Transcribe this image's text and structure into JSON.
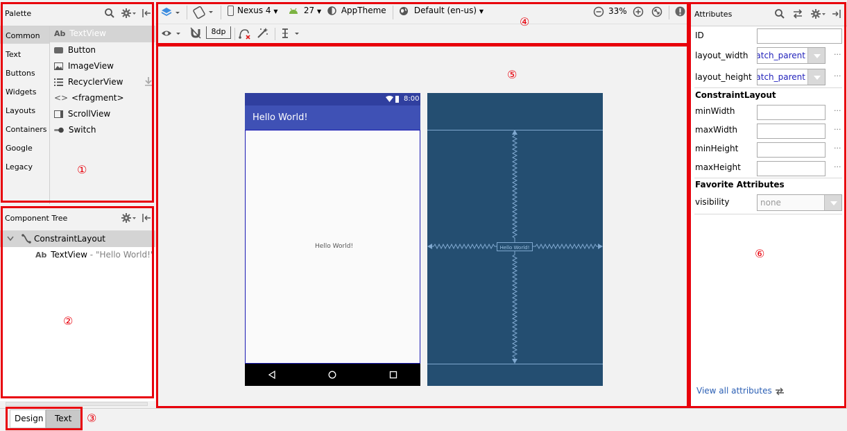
{
  "palette": {
    "title": "Palette",
    "categories": [
      {
        "label": "Common",
        "selected": true
      },
      {
        "label": "Text"
      },
      {
        "label": "Buttons"
      },
      {
        "label": "Widgets"
      },
      {
        "label": "Layouts"
      },
      {
        "label": "Containers"
      },
      {
        "label": "Google"
      },
      {
        "label": "Legacy"
      }
    ],
    "items": [
      {
        "label": "TextView",
        "icon": "Ab",
        "selected": true
      },
      {
        "label": "Button",
        "icon": "button-icon"
      },
      {
        "label": "ImageView",
        "icon": "image-icon"
      },
      {
        "label": "RecyclerView",
        "icon": "list-icon"
      },
      {
        "label": "<fragment>",
        "icon": "code-icon"
      },
      {
        "label": "ScrollView",
        "icon": "scroll-icon"
      },
      {
        "label": "Switch",
        "icon": "switch-icon"
      }
    ]
  },
  "component_tree": {
    "title": "Component Tree",
    "root": "ConstraintLayout",
    "child_label": "TextView",
    "child_detail": "- \"Hello World!\"",
    "child_icon": "Ab"
  },
  "tabs": {
    "design": "Design",
    "text": "Text",
    "active": "Design"
  },
  "toolbar": {
    "device": "Nexus 4",
    "api": "27",
    "theme": "AppTheme",
    "locale": "Default (en-us)",
    "zoom": "33%",
    "margin": "8dp"
  },
  "preview": {
    "status_time": "8:00",
    "app_title": "Hello World!",
    "content_text": "Hello World!",
    "blueprint_text": "Hello World!",
    "colors": {
      "appbar": "#3f51b5",
      "statusbar": "#303f9f",
      "blueprint": "#244e71"
    }
  },
  "attributes": {
    "title": "Attributes",
    "id_label": "ID",
    "id_value": "",
    "layout_width_label": "layout_width",
    "layout_width_value": "match_parent",
    "layout_height_label": "layout_height",
    "layout_height_value": "match_parent",
    "section_constraint": "ConstraintLayout",
    "min_width_label": "minWidth",
    "max_width_label": "maxWidth",
    "min_height_label": "minHeight",
    "max_height_label": "maxHeight",
    "section_favorite": "Favorite Attributes",
    "visibility_label": "visibility",
    "visibility_value": "none",
    "view_all": "View all attributes"
  },
  "annotations": [
    "①",
    "②",
    "③",
    "④",
    "⑤",
    "⑥"
  ]
}
